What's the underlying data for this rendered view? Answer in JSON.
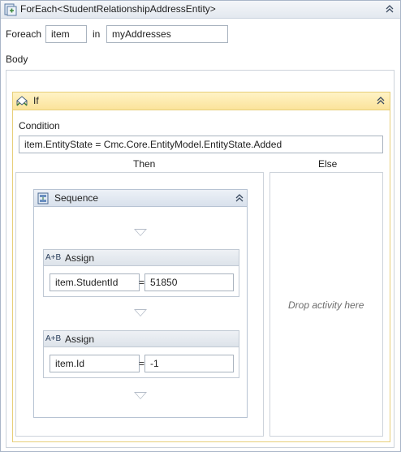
{
  "foreach": {
    "title": "ForEach<StudentRelationshipAddressEntity>",
    "foreach_label": "Foreach",
    "item_value": "item",
    "in_label": "in",
    "collection_value": "myAddresses",
    "body_label": "Body",
    "icon": "foreach-icon"
  },
  "if_activity": {
    "title": "If",
    "icon": "if-icon",
    "condition_label": "Condition",
    "condition_value": "item.EntityState = Cmc.Core.EntityModel.EntityState.Added",
    "then_label": "Then",
    "else_label": "Else",
    "else_hint": "Drop activity here"
  },
  "sequence": {
    "title": "Sequence",
    "icon": "sequence-icon",
    "assigns": [
      {
        "title": "Assign",
        "icon_text": "A+B",
        "to": "item.StudentId",
        "eq": "=",
        "value": "51850"
      },
      {
        "title": "Assign",
        "icon_text": "A+B",
        "to": "item.Id",
        "eq": "=",
        "value": "-1"
      }
    ]
  },
  "colors": {
    "if_header": "#fbe39a",
    "border": "#aab6c8",
    "arrow": "#b4bcc8"
  }
}
